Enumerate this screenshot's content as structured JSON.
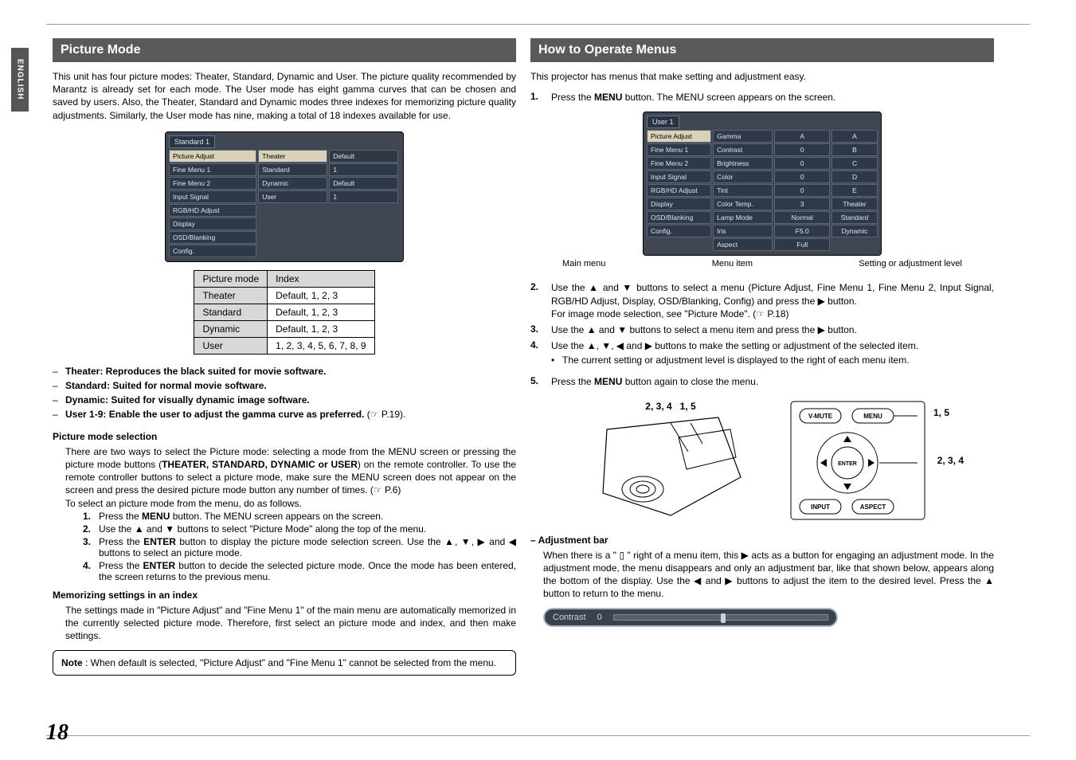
{
  "language_tab": "ENGLISH",
  "page_number": "18",
  "left": {
    "title": "Picture Mode",
    "intro": "This unit has four picture modes: Theater, Standard, Dynamic and User. The picture quality recommended by Marantz is already set for each mode. The User mode has eight gamma curves that can be chosen and saved by users. Also, the Theater, Standard and Dynamic modes three indexes for memorizing picture quality adjustments. Similarly, the User mode has nine, making a total of 18 indexes available for use.",
    "osd": {
      "title": "Standard 1",
      "side_items": [
        "Picture Adjust",
        "Fine Menu 1",
        "Fine Menu 2",
        "Input Signal",
        "RGB/HD Adjust",
        "Display",
        "OSD/Blanking",
        "Config."
      ],
      "right_items": [
        {
          "label": "Theater",
          "val": "Default"
        },
        {
          "label": "Standard",
          "val": "1"
        },
        {
          "label": "Dynamic",
          "val": "Default"
        },
        {
          "label": "User",
          "val": "1"
        }
      ]
    },
    "pm_table": {
      "headers": [
        "Picture mode",
        "Index"
      ],
      "rows": [
        [
          "Theater",
          "Default, 1, 2, 3"
        ],
        [
          "Standard",
          "Default, 1, 2, 3"
        ],
        [
          "Dynamic",
          "Default, 1, 2, 3"
        ],
        [
          "User",
          "1, 2, 3, 4, 5, 6, 7, 8, 9"
        ]
      ]
    },
    "mode_desc": [
      {
        "bold": "Theater: Reproduces the black suited for movie software.",
        "rest": ""
      },
      {
        "bold": "Standard: Suited for normal movie software.",
        "rest": ""
      },
      {
        "bold": "Dynamic: Suited for visually dynamic image software.",
        "rest": ""
      },
      {
        "bold": "User 1-9: Enable the user to adjust the gamma curve as preferred.",
        "rest": " (☞ P.19)."
      }
    ],
    "sel_h": "Picture mode selection",
    "sel_p1_a": "There are two ways to select the Picture mode: selecting a mode from the MENU screen or pressing the picture mode buttons (",
    "sel_p1_bold": "THEATER, STANDARD, DYNAMIC or USER",
    "sel_p1_b": ") on the remote controller. To use the remote controller buttons to select a picture mode, make sure the MENU screen does not appear on the screen and press the desired picture mode button any number of times. (☞ P.6)",
    "sel_p2": "To select an picture mode from the menu, do as follows.",
    "sel_steps": [
      "Press the MENU button. The MENU screen appears on the screen.",
      "Use the ▲ and ▼ buttons to select \"Picture Mode\" along the top of the menu.",
      "Press the ENTER button to display the picture mode selection screen. Use the ▲, ▼, ▶ and ◀ buttons to select an picture mode.",
      "Press the ENTER button to decide the selected picture mode. Once the mode has been entered, the screen returns to the previous menu."
    ],
    "mem_h": "Memorizing settings in an index",
    "mem_p": "The settings made in \"Picture Adjust\" and \"Fine Menu 1\" of the main menu are automatically memorized in the currently selected picture mode. Therefore, first select an picture mode and index, and then make settings.",
    "note_bold": "Note",
    "note_rest": " : When default is selected, \"Picture Adjust\" and \"Fine Menu 1\" cannot be selected from the menu."
  },
  "right": {
    "title": "How to Operate Menus",
    "intro": "This projector has menus that make setting and adjustment easy.",
    "step1": "Press the MENU button. The MENU screen appears on the screen.",
    "osd": {
      "title": "User 1",
      "left_items": [
        "Picture Adjust",
        "Fine Menu 1",
        "Fine Menu 2",
        "Input Signal",
        "RGB/HD Adjust",
        "Display",
        "OSD/Blanking",
        "Config."
      ],
      "mid_items": [
        "Gamma",
        "Contrast",
        "Brightness",
        "Color",
        "Tint",
        "Color Temp.",
        "Lamp Mode",
        "Iris",
        "Aspect"
      ],
      "vals": [
        "A",
        "0",
        "0",
        "0",
        "0",
        "3",
        "Normal",
        "F5.0",
        "Full"
      ],
      "right_col": [
        "A",
        "B",
        "C",
        "D",
        "E",
        "Theater",
        "Standard",
        "Dynamic"
      ]
    },
    "osd_captions": [
      "Main menu",
      "Menu item",
      "Setting or adjustment level"
    ],
    "steps_rest": [
      "Use the ▲ and ▼ buttons to select a menu (Picture Adjust, Fine Menu 1, Fine Menu 2, Input Signal, RGB/HD Adjust, Display, OSD/Blanking, Config) and press the ▶ button.",
      "Use the ▲ and ▼ buttons to select a menu item and press the ▶ button.",
      "Use the ▲, ▼, ◀ and ▶ buttons to make the setting or adjustment of the selected item.",
      "Press the MENU button again to close the menu."
    ],
    "step2_extra": "For image mode selection, see \"Picture Mode\".  (☞ P.18)",
    "step4_bullet": "The current setting or adjustment level is displayed to the right of each menu item.",
    "diag_labels": {
      "left_top": "2, 3, 4",
      "left_top2": "1, 5",
      "right_top": "1, 5",
      "right_side": "2, 3, 4"
    },
    "remote_buttons": {
      "vmute": "V-MUTE",
      "menu": "MENU",
      "enter": "ENTER",
      "input": "INPUT",
      "aspect": "ASPECT"
    },
    "adj_h": "– Adjustment bar",
    "adj_p": "When there is a \" ▯ \" right of a menu item, this ▶ acts as a button for engaging an adjustment mode. In the adjustment mode, the menu disappears and only an adjustment bar, like that shown below, appears along the bottom of the display. Use the ◀ and ▶ buttons to adjust the item to the desired level. Press the ▲ button to return to the menu.",
    "adj_bar": {
      "label": "Contrast",
      "value": "0"
    }
  }
}
